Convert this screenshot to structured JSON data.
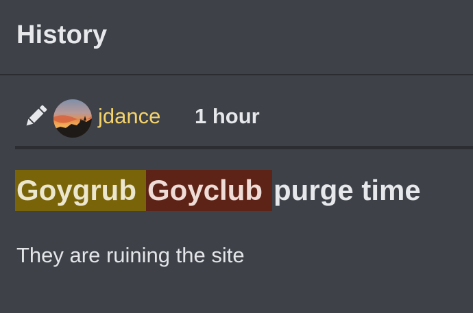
{
  "header": {
    "title": "History"
  },
  "revision": {
    "edit_icon": "pencil-icon",
    "username": "jdance",
    "time_ago": "1 hour"
  },
  "title_diff": {
    "removed": "Goygrub",
    "added": "Goyclub",
    "unchanged": "purge time",
    "removed_color": "#7a6409",
    "added_color": "#5e2317"
  },
  "body": {
    "text": "They are ruining the site"
  },
  "colors": {
    "background": "#3e4148",
    "username": "#f5d36a"
  }
}
